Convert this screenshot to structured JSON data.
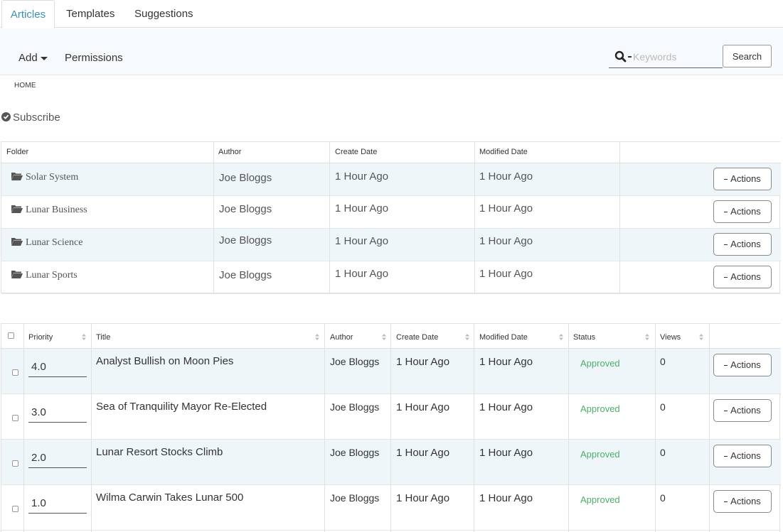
{
  "tabs": [
    {
      "label": "Articles",
      "active": true
    },
    {
      "label": "Templates",
      "active": false
    },
    {
      "label": "Suggestions",
      "active": false
    }
  ],
  "toolbar": {
    "add_label": "Add",
    "permissions_label": "Permissions",
    "search_placeholder": "Keywords",
    "search_button": "Search"
  },
  "breadcrumb": "HOME",
  "subscribe_label": "Subscribe",
  "folders": {
    "headers": {
      "folder": "Folder",
      "author": "Author",
      "create_date": "Create Date",
      "modified_date": "Modified Date"
    },
    "rows": [
      {
        "name": "Solar System",
        "author": "Joe Bloggs",
        "created": "1 Hour Ago",
        "modified": "1 Hour Ago",
        "action": "Actions"
      },
      {
        "name": "Lunar Business",
        "author": "Joe Bloggs",
        "created": "1 Hour Ago",
        "modified": "1 Hour Ago",
        "action": "Actions"
      },
      {
        "name": "Lunar Science",
        "author": "Joe Bloggs",
        "created": "1 Hour Ago",
        "modified": "1 Hour Ago",
        "action": "Actions"
      },
      {
        "name": "Lunar Sports",
        "author": "Joe Bloggs",
        "created": "1 Hour Ago",
        "modified": "1 Hour Ago",
        "action": "Actions"
      }
    ]
  },
  "articles": {
    "headers": {
      "priority": "Priority",
      "title": "Title",
      "author": "Author",
      "create_date": "Create Date",
      "modified_date": "Modified Date",
      "status": "Status",
      "views": "Views"
    },
    "rows": [
      {
        "priority": "4.0",
        "title": "Analyst Bullish on Moon Pies",
        "author": "Joe Bloggs",
        "created": "1 Hour Ago",
        "modified": "1 Hour Ago",
        "status": "Approved",
        "views": "0",
        "action": "Actions"
      },
      {
        "priority": "3.0",
        "title": "Sea of Tranquility Mayor Re-Elected",
        "author": "Joe Bloggs",
        "created": "1 Hour Ago",
        "modified": "1 Hour Ago",
        "status": "Approved",
        "views": "0",
        "action": "Actions"
      },
      {
        "priority": "2.0",
        "title": "Lunar Resort Stocks Climb",
        "author": "Joe Bloggs",
        "created": "1 Hour Ago",
        "modified": "1 Hour Ago",
        "status": "Approved",
        "views": "0",
        "action": "Actions"
      },
      {
        "priority": "1.0",
        "title": "Wilma Carwin Takes Lunar 500",
        "author": "Joe Bloggs",
        "created": "1 Hour Ago",
        "modified": "1 Hour Ago",
        "status": "Approved",
        "views": "0",
        "action": "Actions"
      }
    ]
  },
  "colors": {
    "accent": "#3a8fb7",
    "approved": "#4cae6a",
    "row_alt": "#eff6fa"
  },
  "icons": [
    "search-icon",
    "caret-down-icon",
    "check-circle-icon",
    "folder-open-icon",
    "sort-icon"
  ]
}
